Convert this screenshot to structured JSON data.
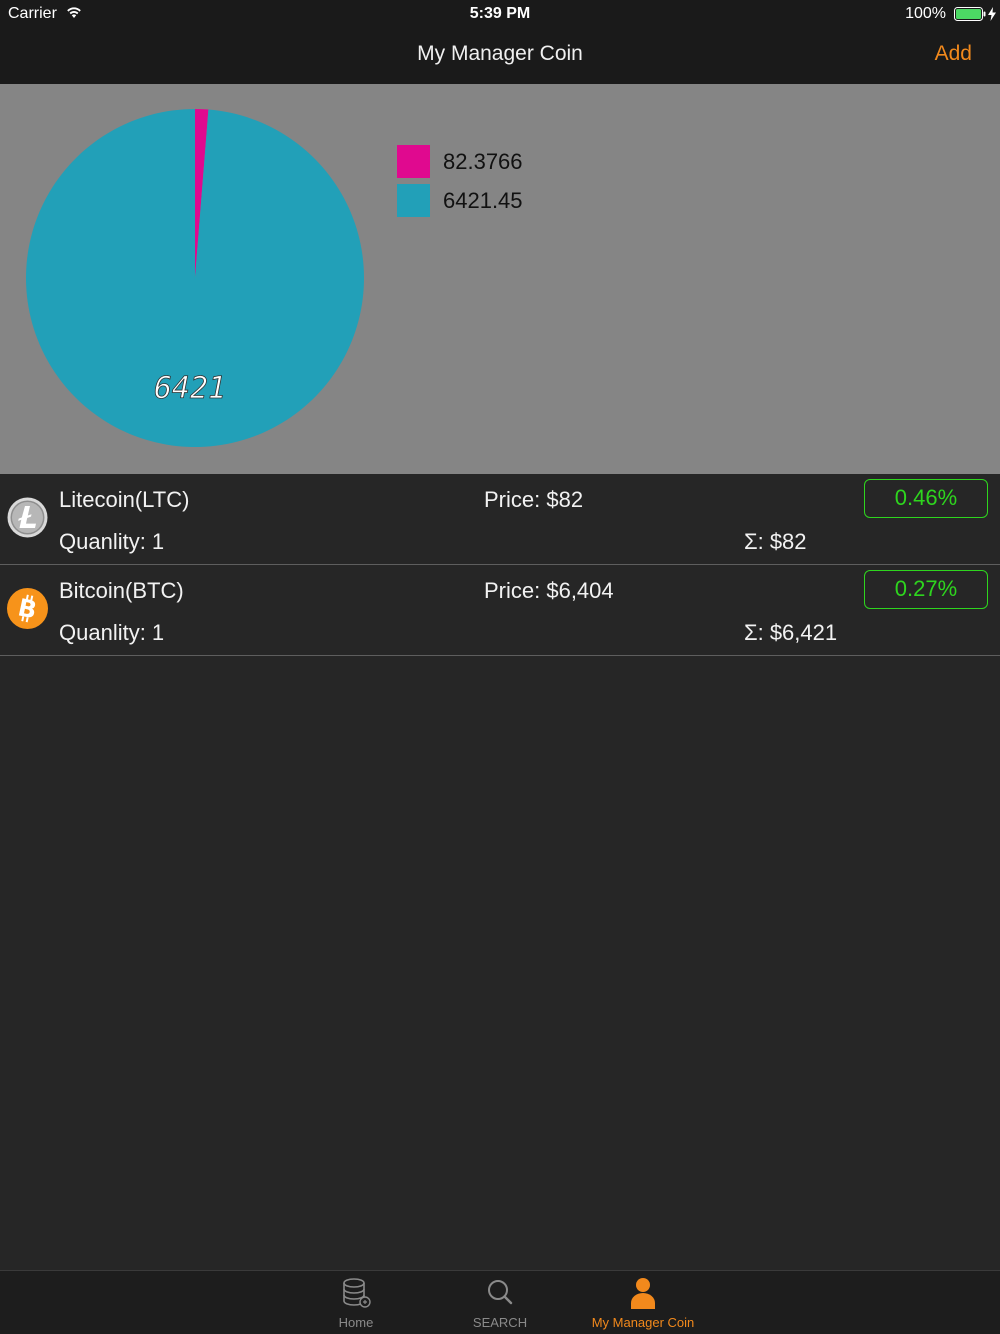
{
  "status_bar": {
    "carrier": "Carrier",
    "time": "5:39 PM",
    "battery": "100%"
  },
  "nav": {
    "title": "My Manager Coin",
    "add_label": "Add",
    "accent_color": "#f2891c"
  },
  "chart_data": {
    "type": "pie",
    "slices": [
      {
        "label": "82.3766",
        "value": 82.3766,
        "color": "#e0098f"
      },
      {
        "label": "6421.45",
        "value": 6421.45,
        "color": "#22a0b8"
      }
    ],
    "slice_value_label": "6421",
    "legend_position": "right"
  },
  "coins": [
    {
      "name": "Litecoin(LTC)",
      "price": "Price: $82",
      "quantity": "Quanlity: 1",
      "total": "Σ: $82",
      "change": "0.46%",
      "logo": "litecoin-logo"
    },
    {
      "name": "Bitcoin(BTC)",
      "price": "Price: $6,404",
      "quantity": "Quanlity: 1",
      "total": "Σ: $6,421",
      "change": "0.27%",
      "logo": "bitcoin-logo"
    }
  ],
  "change_color": "#2ed51e",
  "tabs": [
    {
      "label": "Home",
      "icon": "database-icon",
      "active": false
    },
    {
      "label": "SEARCH",
      "icon": "search-icon",
      "active": false
    },
    {
      "label": "My Manager Coin",
      "icon": "person-icon",
      "active": true
    }
  ]
}
